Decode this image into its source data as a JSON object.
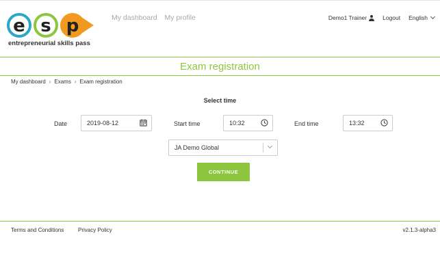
{
  "logo": {
    "letters": [
      "e",
      "s",
      "p"
    ],
    "tagline": "entrepreneurial skills pass"
  },
  "nav": {
    "dashboard": "My dashboard",
    "profile": "My profile"
  },
  "user": {
    "name": "Demo1 Trainer",
    "logout": "Logout",
    "language": "English"
  },
  "page_title": "Exam registration",
  "breadcrumb": [
    "My dashboard",
    "Exams",
    "Exam registration"
  ],
  "form": {
    "heading": "Select time",
    "date_label": "Date",
    "date_value": "2019-08-12",
    "start_label": "Start time",
    "start_value": "10:32",
    "end_label": "End time",
    "end_value": "13:32",
    "organisation_value": "JA Demo Global",
    "continue_label": "CONTINUE"
  },
  "footer": {
    "terms": "Terms and Conditions",
    "privacy": "Privacy Policy",
    "version": "v2.1.3-alpha3"
  },
  "colors": {
    "brand_green": "#8cc63f",
    "logo_blue": "#2ba6c9",
    "logo_orange": "#f29a1f"
  }
}
